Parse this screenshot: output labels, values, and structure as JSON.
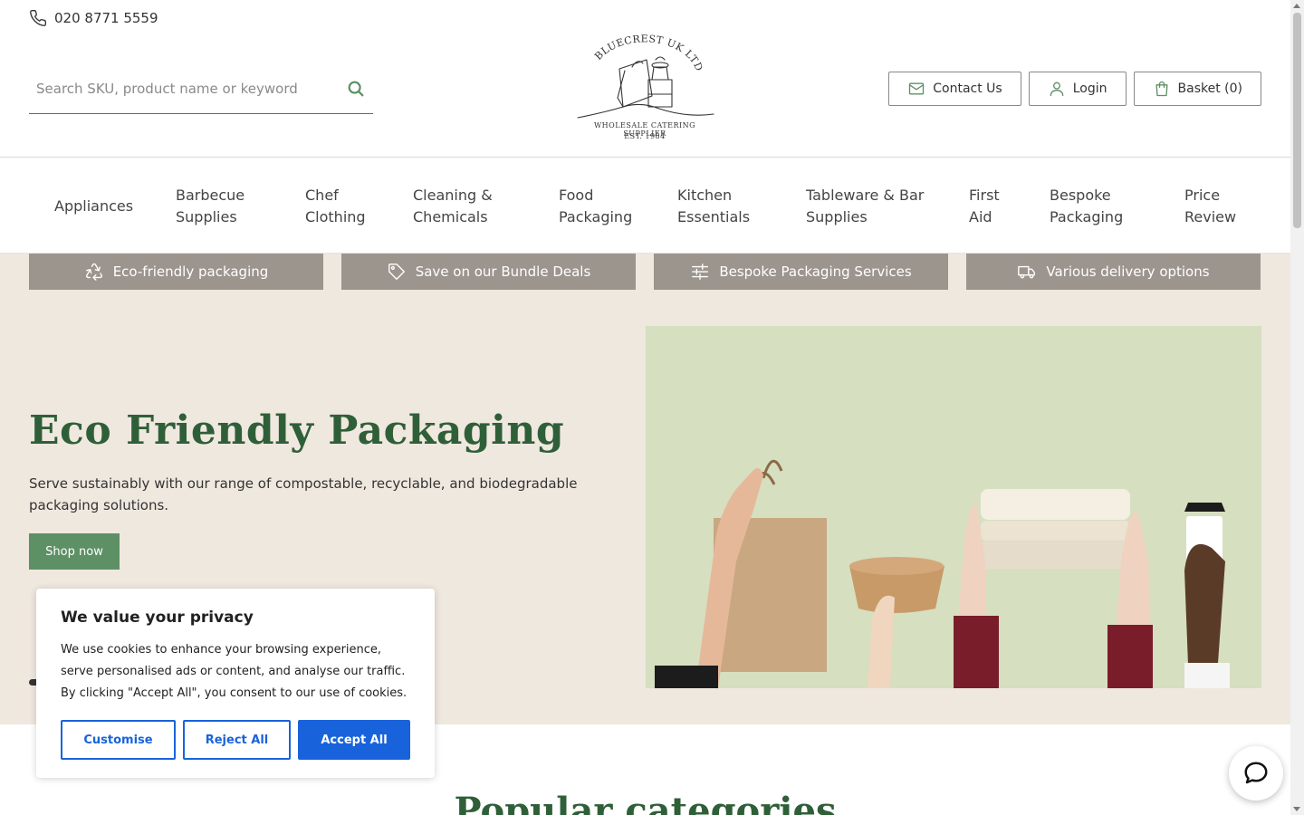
{
  "header": {
    "phone": "020 8771 5559",
    "search_placeholder": "Search SKU, product name or keyword",
    "logo": {
      "arc_text": "BLUECREST UK LTD",
      "tagline": "WHOLESALE CATERING SUPPLIER",
      "established": "EST. 1984"
    },
    "actions": {
      "contact": "Contact Us",
      "login": "Login",
      "basket": "Basket (0)"
    }
  },
  "nav": {
    "items": [
      {
        "line1": "Appliances",
        "line2": ""
      },
      {
        "line1": "Barbecue",
        "line2": "Supplies"
      },
      {
        "line1": "Chef",
        "line2": "Clothing"
      },
      {
        "line1": "Cleaning &",
        "line2": "Chemicals"
      },
      {
        "line1": "Food",
        "line2": "Packaging"
      },
      {
        "line1": "Kitchen",
        "line2": "Essentials"
      },
      {
        "line1": "Tableware & Bar",
        "line2": "Supplies"
      },
      {
        "line1": "First",
        "line2": "Aid"
      },
      {
        "line1": "Bespoke",
        "line2": "Packaging"
      },
      {
        "line1": "Price",
        "line2": "Review"
      }
    ]
  },
  "benefits": [
    {
      "label": "Eco-friendly packaging",
      "icon": "recycle-icon"
    },
    {
      "label": "Save on our Bundle Deals",
      "icon": "tag-icon"
    },
    {
      "label": "Bespoke Packaging Services",
      "icon": "sliders-icon"
    },
    {
      "label": "Various delivery options",
      "icon": "truck-icon"
    }
  ],
  "hero": {
    "title": "Eco Friendly Packaging",
    "description": "Serve sustainably with our range of compostable, recyclable, and biodegradable packaging solutions.",
    "cta": "Shop now"
  },
  "sections": {
    "popular_title": "Popular categories"
  },
  "cookie": {
    "title": "We value your privacy",
    "text": "We use cookies to enhance your browsing experience, serve personalised ads or content, and analyse our traffic. By clicking \"Accept All\", you consent to our use of cookies.",
    "customise": "Customise",
    "reject": "Reject All",
    "accept": "Accept All"
  },
  "colors": {
    "brand_green": "#2f5f38",
    "button_green": "#5e9065",
    "hero_bg": "#efe8df",
    "benefit_bg": "#9c958e",
    "cookie_blue": "#1863dc"
  }
}
